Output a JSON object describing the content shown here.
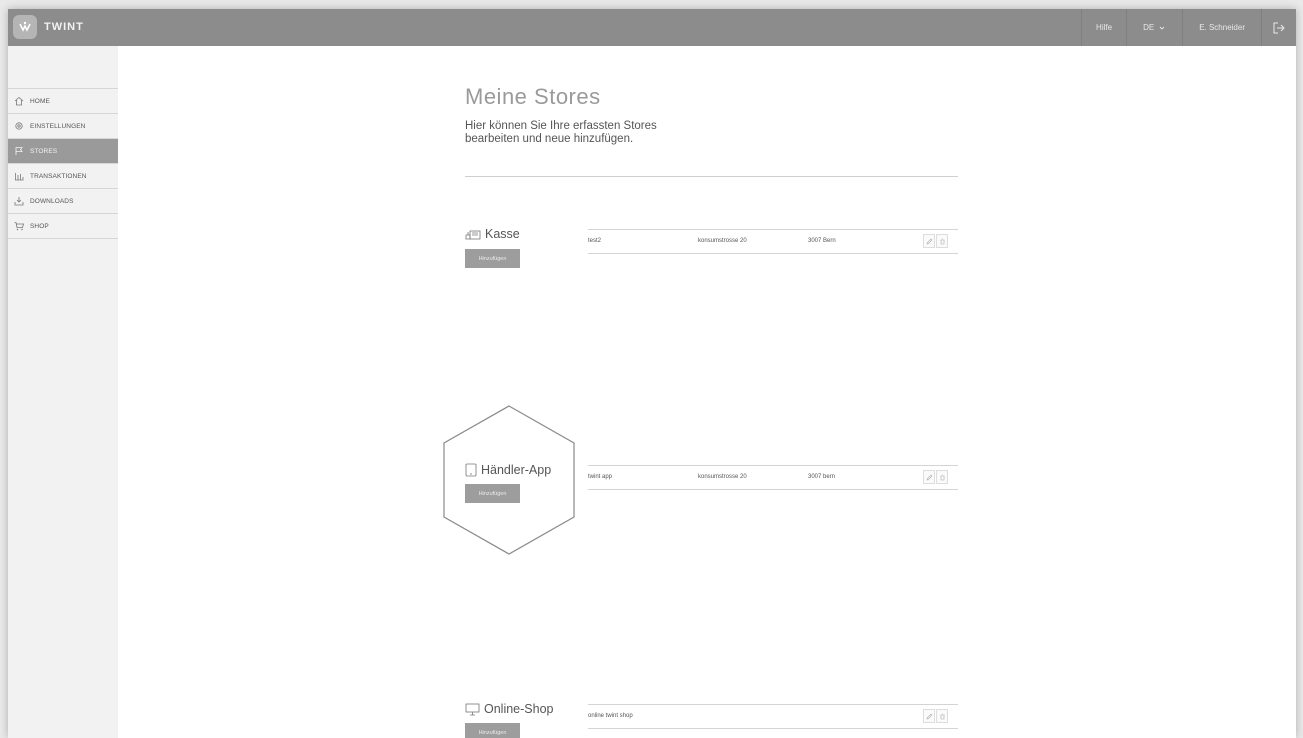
{
  "header": {
    "brand": "TWINT",
    "help": "Hilfe",
    "language": "DE",
    "user": "E. Schneider",
    "icons": {
      "logo": "twint-logo-icon",
      "dropdown": "chevron-down-icon",
      "logout": "logout-icon"
    }
  },
  "sidebar": {
    "items": [
      {
        "label": "HOME",
        "icon": "home-icon"
      },
      {
        "label": "EINSTELLUNGEN",
        "icon": "gear-icon"
      },
      {
        "label": "STORES",
        "icon": "flag-icon",
        "active": true
      },
      {
        "label": "TRANSAKTIONEN",
        "icon": "bar-chart-icon"
      },
      {
        "label": "DOWNLOADS",
        "icon": "download-icon"
      },
      {
        "label": "SHOP",
        "icon": "cart-icon"
      }
    ]
  },
  "main": {
    "title": "Meine Stores",
    "intro": "Hier können Sie Ihre erfassten Stores bearbeiten und neue hinzufügen.",
    "sections": [
      {
        "title": "Kasse",
        "icon": "cash-register-icon",
        "add_label": "Hinzufügen",
        "rows": [
          {
            "name": "test2",
            "street": "konsumstrosse 20",
            "city": "3007 Bern"
          }
        ]
      },
      {
        "title": "Händler-App",
        "icon": "tablet-icon",
        "add_label": "Hinzufügen",
        "rows": [
          {
            "name": "twint app",
            "street": "konsumstrosse 20",
            "city": "3007 bern"
          }
        ]
      },
      {
        "title": "Online-Shop",
        "icon": "monitor-icon",
        "add_label": "Hinzufügen",
        "rows": [
          {
            "name": "online twint shop",
            "street": "",
            "city": ""
          }
        ]
      }
    ],
    "row_actions": [
      "pencil-icon",
      "trash-icon"
    ]
  },
  "colors": {
    "topbar": "#8c8c8c",
    "sidebar_active": "#9a9a9a",
    "button": "#9d9d9d",
    "hexagon": "#8a8a8a"
  }
}
